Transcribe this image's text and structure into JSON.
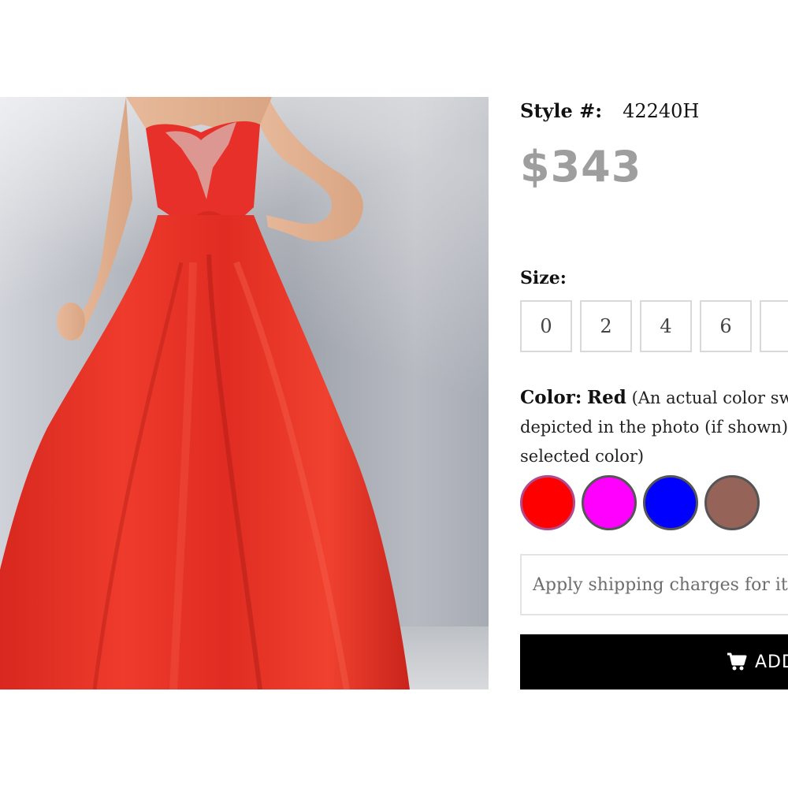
{
  "product": {
    "style_label": "Style #:",
    "style_number": "42240H",
    "price": "$343",
    "dress_color": "#e8302a"
  },
  "size": {
    "label": "Size:",
    "options": [
      "0",
      "2",
      "4",
      "6"
    ]
  },
  "color": {
    "label": "Color:",
    "selected": "Red",
    "note": "(An actual color swa depicted in the photo (if shown) selected color)",
    "swatches": [
      {
        "name": "red",
        "hex": "#ff0000",
        "selected": true
      },
      {
        "name": "magenta",
        "hex": "#ff00ff",
        "selected": false
      },
      {
        "name": "blue",
        "hex": "#0000ff",
        "selected": false
      },
      {
        "name": "brown",
        "hex": "#956358",
        "selected": false
      }
    ]
  },
  "shipping": {
    "text": "Apply shipping charges for it"
  },
  "cart": {
    "button_label": "ADD",
    "icon": "shopping-cart-icon"
  }
}
